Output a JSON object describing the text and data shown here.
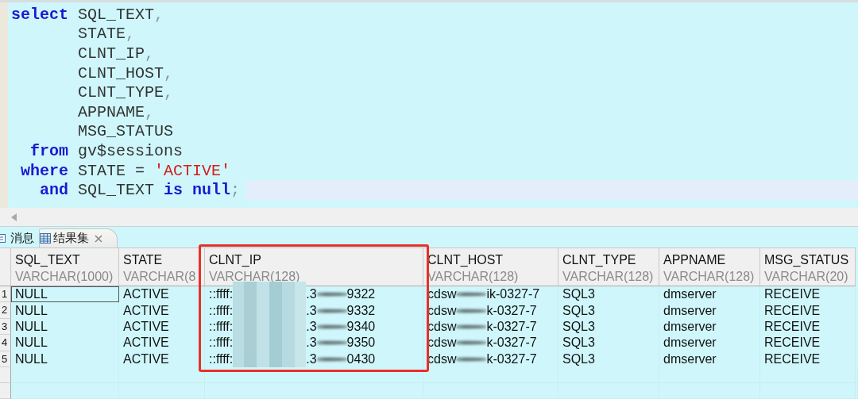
{
  "editor": {
    "lines": [
      {
        "keyword": "select",
        "current": false,
        "tokens": [
          {
            "kind": "plain",
            "text": "SQL_TEXT"
          },
          {
            "kind": "punct",
            "text": ","
          }
        ]
      },
      {
        "current": false,
        "tokens": [
          {
            "kind": "plain",
            "text": "STATE"
          },
          {
            "kind": "punct",
            "text": ","
          }
        ]
      },
      {
        "current": false,
        "tokens": [
          {
            "kind": "plain",
            "text": "CLNT_IP"
          },
          {
            "kind": "punct",
            "text": ","
          }
        ]
      },
      {
        "current": false,
        "tokens": [
          {
            "kind": "plain",
            "text": "CLNT_HOST"
          },
          {
            "kind": "punct",
            "text": ","
          }
        ]
      },
      {
        "current": false,
        "tokens": [
          {
            "kind": "plain",
            "text": "CLNT_TYPE"
          },
          {
            "kind": "punct",
            "text": ","
          }
        ]
      },
      {
        "current": false,
        "tokens": [
          {
            "kind": "plain",
            "text": "APPNAME"
          },
          {
            "kind": "punct",
            "text": ","
          }
        ]
      },
      {
        "current": false,
        "tokens": [
          {
            "kind": "plain",
            "text": "MSG_STATUS"
          }
        ]
      },
      {
        "keyword": "from",
        "current": false,
        "tokens": [
          {
            "kind": "plain",
            "text": "gv$sessions"
          }
        ]
      },
      {
        "keyword": "where",
        "current": false,
        "tokens": [
          {
            "kind": "plain",
            "text": "STATE"
          },
          {
            "kind": "plain",
            "text": "="
          },
          {
            "kind": "string",
            "text": "'ACTIVE'"
          }
        ]
      },
      {
        "keyword": "and",
        "current": true,
        "tokens": [
          {
            "kind": "plain",
            "text": "SQL_TEXT"
          },
          {
            "kind": "keyword",
            "text": "is"
          },
          {
            "kind": "keyword",
            "text": "null"
          },
          {
            "kind": "punct",
            "text": ";"
          }
        ]
      }
    ]
  },
  "tabs": [
    {
      "label": "消息",
      "selected": false,
      "closable": false
    },
    {
      "label": "结果集",
      "selected": true,
      "closable": true
    }
  ],
  "grid": {
    "columns": [
      {
        "name": "SQL_TEXT",
        "type": "VARCHAR(1000)",
        "highlighted": false
      },
      {
        "name": "STATE",
        "type": "VARCHAR(8",
        "highlighted": false
      },
      {
        "name": "CLNT_IP",
        "type": "VARCHAR(128)",
        "highlighted": true
      },
      {
        "name": "CLNT_HOST",
        "type": "VARCHAR(128)",
        "highlighted": false
      },
      {
        "name": "CLNT_TYPE",
        "type": "VARCHAR(128)",
        "highlighted": false
      },
      {
        "name": "APPNAME",
        "type": "VARCHAR(128)",
        "highlighted": false
      },
      {
        "name": "MSG_STATUS",
        "type": "VARCHAR(20)",
        "highlighted": false
      }
    ],
    "rows": [
      {
        "number": "1",
        "selected": true,
        "cells": [
          {
            "kind": "text",
            "text": "NULL"
          },
          {
            "kind": "text",
            "text": "ACTIVE"
          },
          {
            "kind": "redacted",
            "parts": [
              "::ffff:",
              ".3",
              "9322"
            ]
          },
          {
            "kind": "redacted",
            "parts": [
              "cdsw",
              "ik-0327-7"
            ]
          },
          {
            "kind": "text",
            "text": "SQL3"
          },
          {
            "kind": "text",
            "text": "dmserver"
          },
          {
            "kind": "text",
            "text": "RECEIVE"
          }
        ]
      },
      {
        "number": "2",
        "selected": false,
        "cells": [
          {
            "kind": "text",
            "text": "NULL"
          },
          {
            "kind": "text",
            "text": "ACTIVE"
          },
          {
            "kind": "redacted",
            "parts": [
              "::ffff:",
              ".3",
              "9332"
            ]
          },
          {
            "kind": "redacted",
            "parts": [
              "cdsw",
              "k-0327-7"
            ]
          },
          {
            "kind": "text",
            "text": "SQL3"
          },
          {
            "kind": "text",
            "text": "dmserver"
          },
          {
            "kind": "text",
            "text": "RECEIVE"
          }
        ]
      },
      {
        "number": "3",
        "selected": false,
        "cells": [
          {
            "kind": "text",
            "text": "NULL"
          },
          {
            "kind": "text",
            "text": "ACTIVE"
          },
          {
            "kind": "redacted",
            "parts": [
              "::ffff:",
              ".3",
              "9340"
            ]
          },
          {
            "kind": "redacted",
            "parts": [
              "cdsw",
              "k-0327-7"
            ]
          },
          {
            "kind": "text",
            "text": "SQL3"
          },
          {
            "kind": "text",
            "text": "dmserver"
          },
          {
            "kind": "text",
            "text": "RECEIVE"
          }
        ]
      },
      {
        "number": "4",
        "selected": false,
        "cells": [
          {
            "kind": "text",
            "text": "NULL"
          },
          {
            "kind": "text",
            "text": "ACTIVE"
          },
          {
            "kind": "redacted",
            "parts": [
              "::ffff:",
              ".3",
              "9350"
            ]
          },
          {
            "kind": "redacted",
            "parts": [
              "cdsw",
              "k-0327-7"
            ]
          },
          {
            "kind": "text",
            "text": "SQL3"
          },
          {
            "kind": "text",
            "text": "dmserver"
          },
          {
            "kind": "text",
            "text": "RECEIVE"
          }
        ]
      },
      {
        "number": "5",
        "selected": false,
        "cells": [
          {
            "kind": "text",
            "text": "NULL"
          },
          {
            "kind": "text",
            "text": "ACTIVE"
          },
          {
            "kind": "redacted",
            "parts": [
              "::ffff:",
              ".3",
              "0430"
            ]
          },
          {
            "kind": "redacted",
            "parts": [
              "cdsw",
              "k-0327-7"
            ]
          },
          {
            "kind": "text",
            "text": "SQL3"
          },
          {
            "kind": "text",
            "text": "dmserver"
          },
          {
            "kind": "text",
            "text": "RECEIVE"
          }
        ]
      }
    ]
  }
}
